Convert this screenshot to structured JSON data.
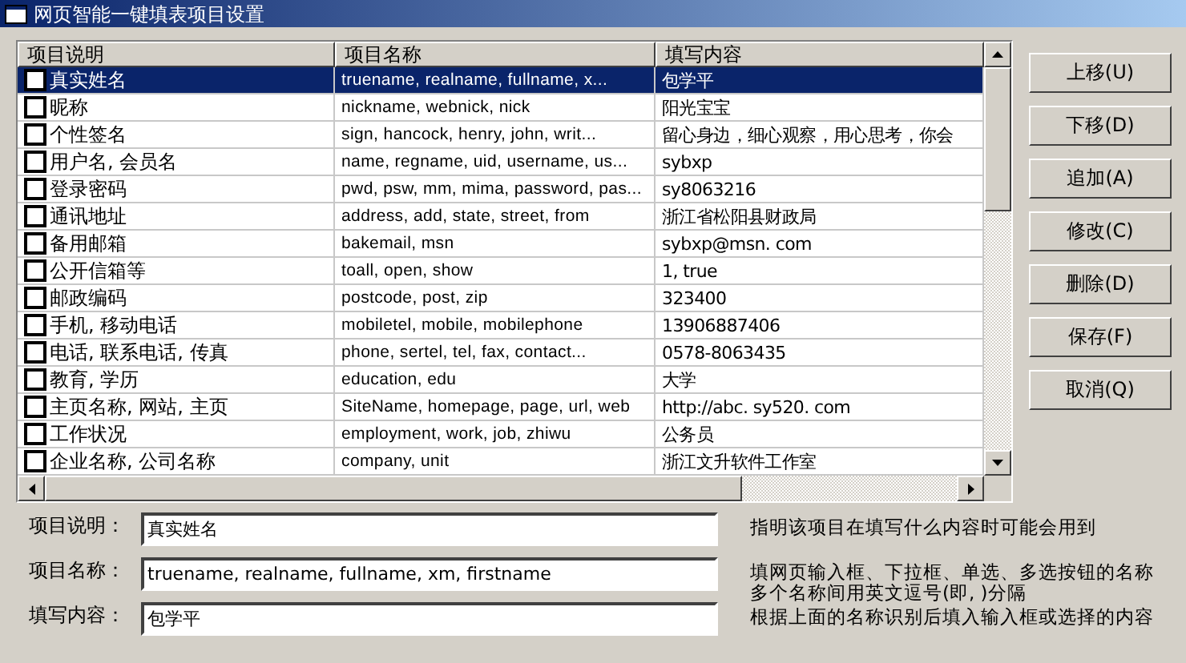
{
  "window": {
    "title": "网页智能一键填表项目设置"
  },
  "table": {
    "columns": [
      "项目说明",
      "项目名称",
      "填写内容"
    ],
    "rows": [
      {
        "description": "真实姓名",
        "names": "truename, realname, fullname, x...",
        "content": "包学平",
        "checked": false,
        "selected": true
      },
      {
        "description": "昵称",
        "names": "nickname, webnick, nick",
        "content": "阳光宝宝",
        "checked": false,
        "selected": false
      },
      {
        "description": "个性签名",
        "names": "sign, hancock, henry, john, writ...",
        "content": "留心身边，细心观察，用心思考，你会",
        "checked": false,
        "selected": false
      },
      {
        "description": "用户名, 会员名",
        "names": "name, regname, uid, username, us...",
        "content": "sybxp",
        "checked": false,
        "selected": false
      },
      {
        "description": "登录密码",
        "names": "pwd, psw, mm, mima, password, pas...",
        "content": "sy8063216",
        "checked": false,
        "selected": false
      },
      {
        "description": "通讯地址",
        "names": "address, add, state, street, from",
        "content": "浙江省松阳县财政局",
        "checked": false,
        "selected": false
      },
      {
        "description": "备用邮箱",
        "names": "bakemail, msn",
        "content": "sybxp@msn. com",
        "checked": false,
        "selected": false
      },
      {
        "description": "公开信箱等",
        "names": "toall, open, show",
        "content": "1, true",
        "checked": false,
        "selected": false
      },
      {
        "description": "邮政编码",
        "names": "postcode, post, zip",
        "content": "323400",
        "checked": false,
        "selected": false
      },
      {
        "description": "手机, 移动电话",
        "names": "mobiletel, mobile, mobilephone",
        "content": "13906887406",
        "checked": false,
        "selected": false
      },
      {
        "description": "电话, 联系电话, 传真",
        "names": "phone, sertel, tel, fax, contact...",
        "content": "0578-8063435",
        "checked": false,
        "selected": false
      },
      {
        "description": "教育, 学历",
        "names": "education, edu",
        "content": "大学",
        "checked": false,
        "selected": false
      },
      {
        "description": "主页名称, 网站, 主页",
        "names": "SiteName, homepage, page, url, web",
        "content": "http://abc. sy520. com",
        "checked": false,
        "selected": false
      },
      {
        "description": "工作状况",
        "names": "employment, work, job, zhiwu",
        "content": "公务员",
        "checked": false,
        "selected": false
      },
      {
        "description": "企业名称, 公司名称",
        "names": "company, unit",
        "content": "浙江文升软件工作室",
        "checked": false,
        "selected": false
      }
    ]
  },
  "buttons": [
    "上移(U)",
    "下移(D)",
    "追加(A)",
    "修改(C)",
    "删除(D)",
    "保存(F)",
    "取消(Q)"
  ],
  "form": [
    {
      "label": "项目说明：",
      "value": "真实姓名",
      "hint_lines": [
        "指明该项目在填写什么内容时可能会用到"
      ]
    },
    {
      "label": "项目名称：",
      "value": "truename, realname, fullname, xm, firstname",
      "hint_lines": [
        "填网页输入框、下拉框、单选、多选按钮的名称",
        "多个名称间用英文逗号(即, )分隔"
      ]
    },
    {
      "label": "填写内容：",
      "value": "包学平",
      "hint_lines": [
        "根据上面的名称识别后填入输入框或选择的内容"
      ]
    }
  ]
}
